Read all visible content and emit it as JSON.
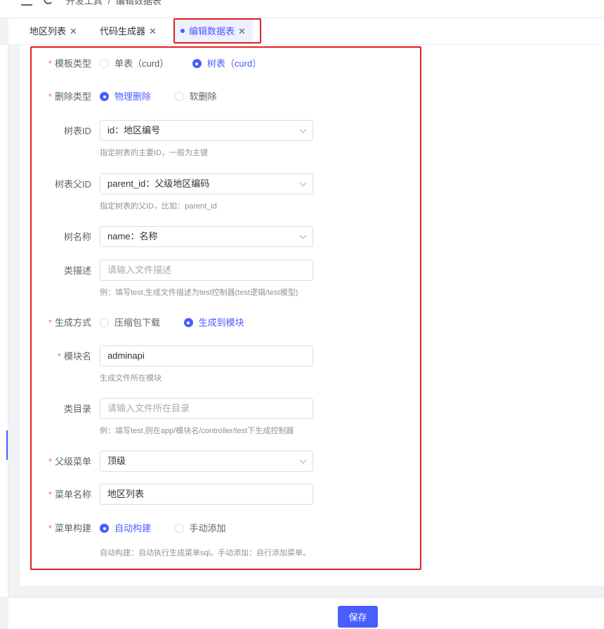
{
  "topbar": {
    "crumbs": [
      "开发工具",
      "/",
      "编辑数据表"
    ]
  },
  "tabs": [
    {
      "label": "地区列表",
      "active": false
    },
    {
      "label": "代码生成器",
      "active": false
    },
    {
      "label": "编辑数据表",
      "active": true
    }
  ],
  "form": {
    "template_type": {
      "label": "模板类型",
      "required": true,
      "options": [
        "单表（curd）",
        "树表（curd）"
      ],
      "selected": 1
    },
    "delete_type": {
      "label": "删除类型",
      "required": true,
      "options": [
        "物理删除",
        "软删除"
      ],
      "selected": 0
    },
    "tree_id": {
      "label": "树表ID",
      "value": "id：地区编号",
      "help": "指定树表的主要ID，一般为主键"
    },
    "tree_pid": {
      "label": "树表父ID",
      "value": "parent_id：父级地区编码",
      "help": "指定树表的父ID，比如：parent_id"
    },
    "tree_name": {
      "label": "树名称",
      "value": "name：名称"
    },
    "class_desc": {
      "label": "类描述",
      "placeholder": "请输入文件描述",
      "help": "例：填写test,生成文件描述为test控制器(test逻辑/test模型)"
    },
    "gen_mode": {
      "label": "生成方式",
      "required": true,
      "options": [
        "压缩包下载",
        "生成到模块"
      ],
      "selected": 1
    },
    "module_name": {
      "label": "模块名",
      "required": true,
      "value": "adminapi",
      "help": "生成文件所在模块"
    },
    "class_dir": {
      "label": "类目录",
      "placeholder": "请输入文件所在目录",
      "help": "例：填写test,则在app/模块名/controller/test下生成控制器"
    },
    "parent_menu": {
      "label": "父级菜单",
      "required": true,
      "value": "顶级"
    },
    "menu_name": {
      "label": "菜单名称",
      "required": true,
      "value": "地区列表"
    },
    "menu_build": {
      "label": "菜单构建",
      "required": true,
      "options": [
        "自动构建",
        "手动添加"
      ],
      "selected": 0,
      "help": "自动构建：自动执行生成菜单sql。手动添加：自行添加菜单。"
    }
  },
  "footer": {
    "save_label": "保存"
  },
  "colors": {
    "primary": "#4a5dff",
    "required": "#f56c6c",
    "highlight": "#e02020"
  }
}
